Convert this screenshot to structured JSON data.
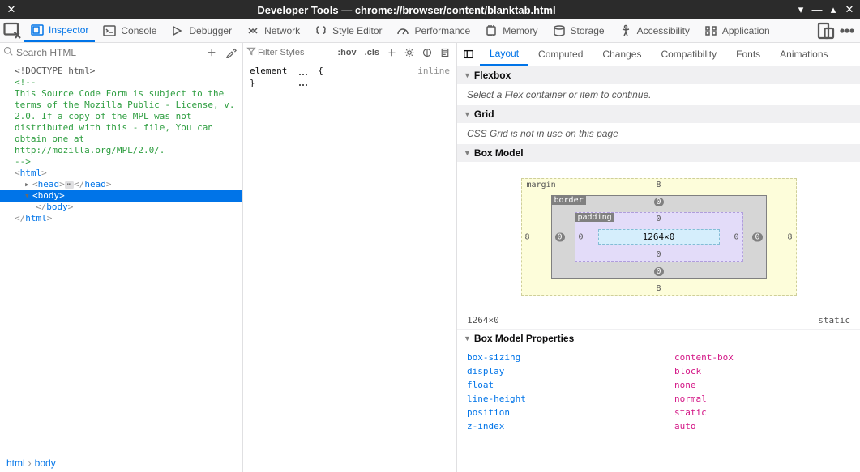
{
  "window": {
    "title": "Developer Tools — chrome://browser/content/blanktab.html"
  },
  "toolbar": {
    "tabs": [
      "Inspector",
      "Console",
      "Debugger",
      "Network",
      "Style Editor",
      "Performance",
      "Memory",
      "Storage",
      "Accessibility",
      "Application"
    ]
  },
  "search": {
    "placeholder": "Search HTML"
  },
  "filter": {
    "placeholder": "Filter Styles",
    "hov": ":hov",
    "cls": ".cls"
  },
  "htmltree": {
    "doctype": "<!DOCTYPE html>",
    "comment": "<!-- \nThis Source Code Form is subject to the terms of the Mozilla Public - License, v. 2.0. If a copy of the MPL was not distributed with this - file, You can obtain one at http://mozilla.org/MPL/2.0/. \n-->",
    "tags": {
      "html": "html",
      "head": "head",
      "body": "body"
    }
  },
  "breadcrumb": {
    "root": "html",
    "current": "body"
  },
  "rules": {
    "selector": "element",
    "brace_open": "{",
    "brace_close": "}",
    "inline": "inline"
  },
  "rtabs": [
    "Layout",
    "Computed",
    "Changes",
    "Compatibility",
    "Fonts",
    "Animations"
  ],
  "layout": {
    "flexbox": {
      "title": "Flexbox",
      "msg": "Select a Flex container or item to continue."
    },
    "grid": {
      "title": "Grid",
      "msg": "CSS Grid is not in use on this page"
    },
    "boxmodel": {
      "title": "Box Model",
      "margin": {
        "label": "margin",
        "top": "8",
        "right": "8",
        "bottom": "8",
        "left": "8"
      },
      "border": {
        "label": "border",
        "top": "0",
        "right": "0",
        "bottom": "0",
        "left": "0"
      },
      "padding": {
        "label": "padding",
        "top": "0",
        "right": "0",
        "bottom": "0",
        "left": "0"
      },
      "content": "1264×0",
      "stats_size": "1264×0",
      "stats_pos": "static"
    },
    "props": {
      "title": "Box Model Properties",
      "rows": [
        {
          "name": "box-sizing",
          "value": "content-box"
        },
        {
          "name": "display",
          "value": "block"
        },
        {
          "name": "float",
          "value": "none"
        },
        {
          "name": "line-height",
          "value": "normal"
        },
        {
          "name": "position",
          "value": "static"
        },
        {
          "name": "z-index",
          "value": "auto"
        }
      ]
    }
  }
}
